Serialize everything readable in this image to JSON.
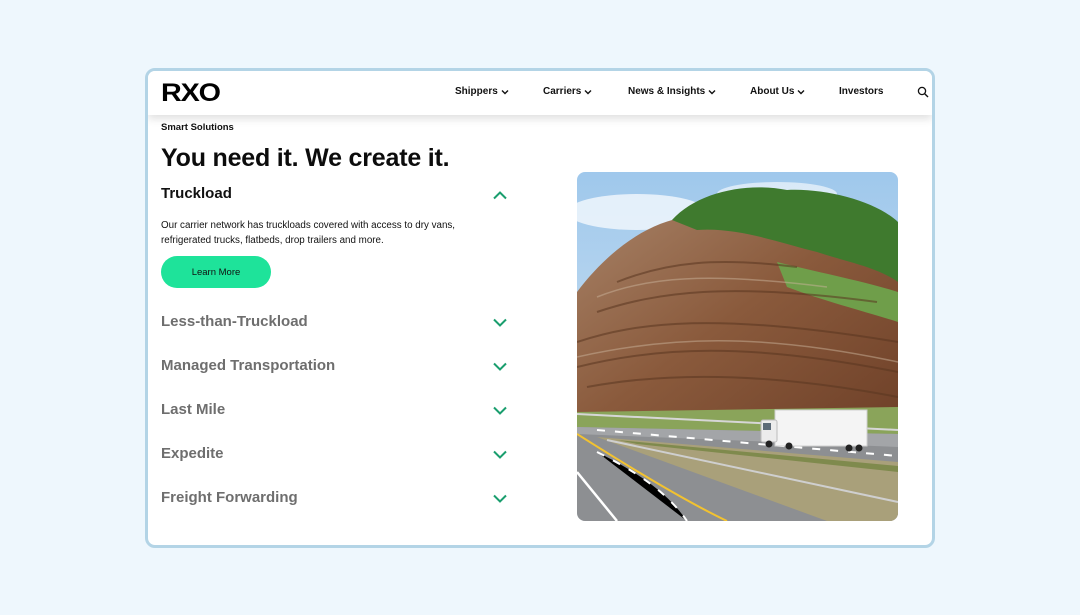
{
  "brand": {
    "logo_text": "RXO"
  },
  "nav": {
    "items": [
      {
        "label": "Shippers",
        "has_dropdown": true
      },
      {
        "label": "Carriers",
        "has_dropdown": true
      },
      {
        "label": "News & Insights",
        "has_dropdown": true
      },
      {
        "label": "About Us",
        "has_dropdown": true
      },
      {
        "label": "Investors",
        "has_dropdown": false
      }
    ],
    "search_icon": "search-icon"
  },
  "hero": {
    "eyebrow": "Smart Solutions",
    "headline": "You need it. We create it."
  },
  "accordion": {
    "items": [
      {
        "title": "Truckload",
        "expanded": true,
        "description": "Our carrier network has truckloads covered with access to dry vans, refrigerated trucks, flatbeds, drop trailers and more.",
        "cta_label": "Learn More"
      },
      {
        "title": "Less-than-Truckload",
        "expanded": false
      },
      {
        "title": "Managed Transportation",
        "expanded": false
      },
      {
        "title": "Last Mile",
        "expanded": false
      },
      {
        "title": "Expedite",
        "expanded": false
      },
      {
        "title": "Freight Forwarding",
        "expanded": false
      }
    ]
  },
  "colors": {
    "accent": "#1ee39a",
    "chevron": "#1a9e6e",
    "page_background": "#eef7fd",
    "frame_border": "#b3d4e6"
  }
}
